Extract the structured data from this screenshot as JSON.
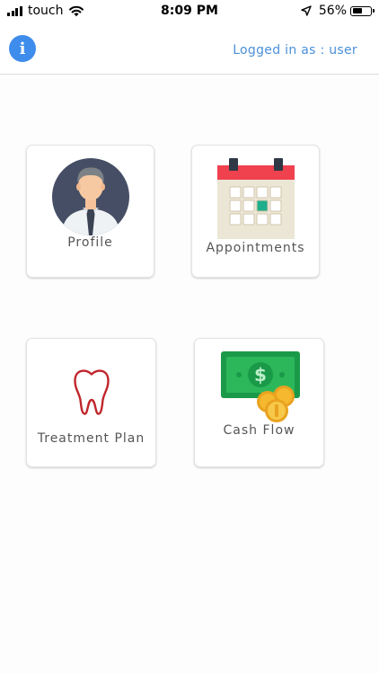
{
  "status_bar": {
    "carrier": "touch",
    "time": "8:09 PM",
    "battery_percent": "56%",
    "battery_level": 0.56,
    "icons": [
      "signal-icon",
      "wifi-icon",
      "location-arrow-icon",
      "battery-icon"
    ]
  },
  "header": {
    "info_label": "i",
    "logged_in_text": "Logged in as : user"
  },
  "tiles": [
    {
      "label": "Profile",
      "icon": "profile-avatar-icon"
    },
    {
      "label": "Appointments",
      "icon": "calendar-icon"
    },
    {
      "label": "Treatment Plan",
      "icon": "tooth-icon"
    },
    {
      "label": "Cash Flow",
      "icon": "money-icon"
    }
  ],
  "colors": {
    "accent_blue": "#3e8ded",
    "link_blue": "#4a90d9",
    "calendar_red": "#f0414f",
    "tooth_red": "#c0262c",
    "money_green": "#1a9a48",
    "coin_gold": "#f5b82e"
  }
}
